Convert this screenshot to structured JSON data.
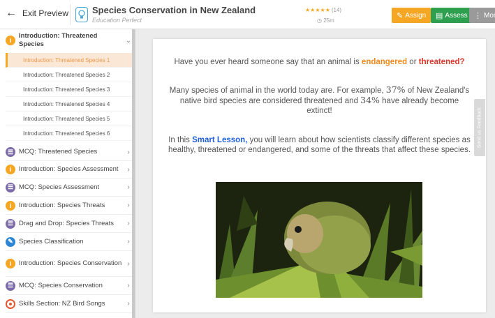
{
  "header": {
    "exit_label": "Exit Preview",
    "title": "Species Conservation in New Zealand",
    "subtitle": "Education Perfect",
    "rating_stars": "★★★★★",
    "rating_count": "(14)",
    "time": "25m",
    "assign_label": "Assign",
    "assess_label": "Assess",
    "more_label": "More",
    "accent_colors": {
      "assign": "#f5a623",
      "assess": "#2e9e4f",
      "more": "#9a9a9a"
    }
  },
  "sidebar": {
    "section": {
      "label": "Introduction: Threatened Species",
      "icon": "info-icon",
      "subitems": [
        "Introduction: Threatened Species 1",
        "Introduction: Threatened Species 2",
        "Introduction: Threatened Species 3",
        "Introduction: Threatened Species 4",
        "Introduction: Threatened Species 5",
        "Introduction: Threatened Species 6"
      ],
      "active_subitem": 0
    },
    "items": [
      {
        "label": "MCQ: Threatened Species",
        "icon": "list-icon"
      },
      {
        "label": "Introduction: Species Assessment",
        "icon": "info-icon"
      },
      {
        "label": "MCQ: Species Assessment",
        "icon": "list-icon"
      },
      {
        "label": "Introduction: Species Threats",
        "icon": "info-icon"
      },
      {
        "label": "Drag and Drop: Species Threats",
        "icon": "list-icon"
      },
      {
        "label": "Species Classification",
        "icon": "pencil-icon"
      },
      {
        "label": "Introduction: Species Conservation",
        "icon": "info-icon"
      },
      {
        "label": "MCQ: Species Conservation",
        "icon": "list-icon"
      },
      {
        "label": "Skills Section: NZ Bird Songs",
        "icon": "target-icon"
      }
    ]
  },
  "content": {
    "p1": {
      "before": "Have you ever heard someone say that an animal is ",
      "endangered": "endangered",
      "or": " or ",
      "threatened": "threatened?"
    },
    "p2": {
      "before": "Many species of animal in the world today are. For example, ",
      "pct1": "37%",
      "middle": " of New Zealand's native bird species are considered threatened and ",
      "pct2": "34%",
      "after": " have already become extinct!"
    },
    "p3": {
      "before": "In this ",
      "smart": "Smart Lesson,",
      "after": " you will learn about how scientists classify different species as healthy, threatened or endangered, and some of the threats that affect these species."
    },
    "image_subject": "Kakapo parrot in grass"
  },
  "feedback_label": "Send us Feedback"
}
